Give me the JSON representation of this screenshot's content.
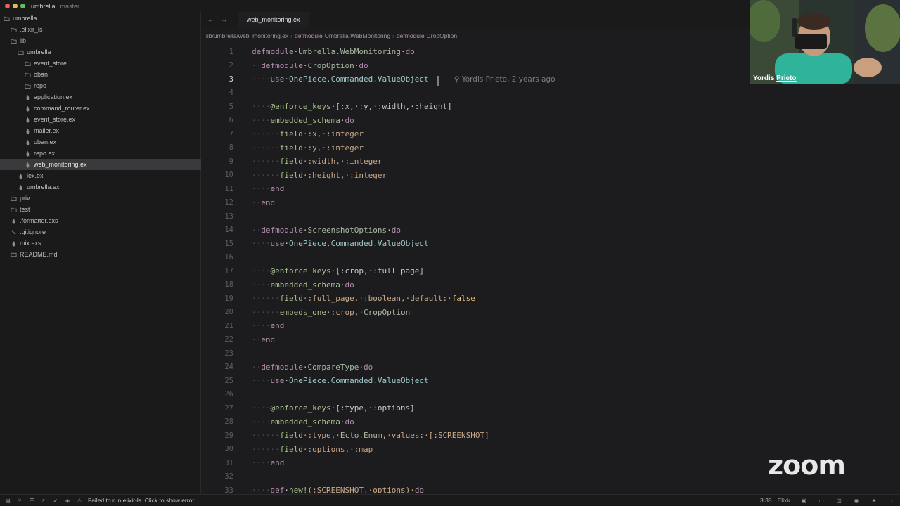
{
  "window": {
    "project": "umbrella",
    "branch": "master"
  },
  "sidebar": {
    "items": [
      {
        "label": "umbrella",
        "icon": "chevron-down-icon",
        "indent": 0,
        "type": "folder-open"
      },
      {
        "label": ".elixir_ls",
        "icon": "folder-icon",
        "indent": 1,
        "type": "folder"
      },
      {
        "label": "lib",
        "icon": "folder-icon",
        "indent": 1,
        "type": "folder-open"
      },
      {
        "label": "umbrella",
        "icon": "folder-icon",
        "indent": 2,
        "type": "folder-open"
      },
      {
        "label": "event_store",
        "icon": "folder-icon",
        "indent": 3,
        "type": "folder"
      },
      {
        "label": "oban",
        "icon": "folder-icon",
        "indent": 3,
        "type": "folder"
      },
      {
        "label": "repo",
        "icon": "folder-icon",
        "indent": 3,
        "type": "folder"
      },
      {
        "label": "application.ex",
        "icon": "elixir-file-icon",
        "indent": 3,
        "type": "file"
      },
      {
        "label": "command_router.ex",
        "icon": "elixir-file-icon",
        "indent": 3,
        "type": "file"
      },
      {
        "label": "event_store.ex",
        "icon": "elixir-file-icon",
        "indent": 3,
        "type": "file"
      },
      {
        "label": "mailer.ex",
        "icon": "elixir-file-icon",
        "indent": 3,
        "type": "file"
      },
      {
        "label": "oban.ex",
        "icon": "elixir-file-icon",
        "indent": 3,
        "type": "file"
      },
      {
        "label": "repo.ex",
        "icon": "elixir-file-icon",
        "indent": 3,
        "type": "file"
      },
      {
        "label": "web_monitoring.ex",
        "icon": "elixir-file-icon",
        "indent": 3,
        "type": "file",
        "selected": true
      },
      {
        "label": "iex.ex",
        "icon": "elixir-file-icon",
        "indent": 2,
        "type": "file"
      },
      {
        "label": "umbrella.ex",
        "icon": "elixir-file-icon",
        "indent": 2,
        "type": "file"
      },
      {
        "label": "priv",
        "icon": "folder-icon",
        "indent": 1,
        "type": "folder"
      },
      {
        "label": "test",
        "icon": "folder-icon",
        "indent": 1,
        "type": "folder"
      },
      {
        "label": ".formatter.exs",
        "icon": "elixir-file-icon",
        "indent": 1,
        "type": "file"
      },
      {
        "label": ".gitignore",
        "icon": "git-icon",
        "indent": 1,
        "type": "file"
      },
      {
        "label": "mix.exs",
        "icon": "elixir-file-icon",
        "indent": 1,
        "type": "file"
      },
      {
        "label": "README.md",
        "icon": "markdown-icon",
        "indent": 1,
        "type": "file"
      }
    ]
  },
  "tabs": {
    "back": "←",
    "forward": "→",
    "active": "web_monitoring.ex"
  },
  "breadcrumb": {
    "path": "lib/umbrella/web_monitoring.ex",
    "kw1": "defmodule",
    "mod1": "Umbrella.WebMonitoring",
    "kw2": "defmodule",
    "mod2": "CropOption",
    "sep": "›"
  },
  "editor": {
    "current_line": 3,
    "blame": "Yordis Prieto, 2 years ago",
    "lines": [
      {
        "n": 1,
        "tokens": [
          [
            "kw",
            "defmodule"
          ],
          [
            "",
            "·"
          ],
          [
            "mod",
            "Umbrella.WebMonitoring"
          ],
          [
            "",
            "·"
          ],
          [
            "kw",
            "do"
          ]
        ]
      },
      {
        "n": 2,
        "tokens": [
          [
            "ws",
            "··"
          ],
          [
            "kw",
            "defmodule"
          ],
          [
            "",
            "·"
          ],
          [
            "mod",
            "CropOption"
          ],
          [
            "",
            "·"
          ],
          [
            "kw",
            "do"
          ]
        ]
      },
      {
        "n": 3,
        "tokens": [
          [
            "ws",
            "····"
          ],
          [
            "kw",
            "use"
          ],
          [
            "",
            "·"
          ],
          [
            "mod2",
            "OnePiece.Commanded.ValueObject"
          ]
        ]
      },
      {
        "n": 4,
        "tokens": []
      },
      {
        "n": 5,
        "tokens": [
          [
            "ws",
            "····"
          ],
          [
            "attr",
            "@enforce_keys"
          ],
          [
            "",
            "·[:x,·:y,·:width,·:height]"
          ]
        ]
      },
      {
        "n": 6,
        "tokens": [
          [
            "ws",
            "····"
          ],
          [
            "fn",
            "embedded_schema"
          ],
          [
            "",
            "·"
          ],
          [
            "kw",
            "do"
          ]
        ]
      },
      {
        "n": 7,
        "tokens": [
          [
            "ws",
            "······"
          ],
          [
            "fn",
            "field"
          ],
          [
            "atom",
            "·:x,·:integer"
          ]
        ]
      },
      {
        "n": 8,
        "tokens": [
          [
            "ws",
            "······"
          ],
          [
            "fn",
            "field"
          ],
          [
            "atom",
            "·:y,·:integer"
          ]
        ]
      },
      {
        "n": 9,
        "tokens": [
          [
            "ws",
            "······"
          ],
          [
            "fn",
            "field"
          ],
          [
            "atom",
            "·:width,·:integer"
          ]
        ]
      },
      {
        "n": 10,
        "tokens": [
          [
            "ws",
            "······"
          ],
          [
            "fn",
            "field"
          ],
          [
            "atom",
            "·:height,·:integer"
          ]
        ]
      },
      {
        "n": 11,
        "tokens": [
          [
            "ws",
            "····"
          ],
          [
            "kw",
            "end"
          ]
        ]
      },
      {
        "n": 12,
        "tokens": [
          [
            "ws",
            "··"
          ],
          [
            "kw",
            "end"
          ]
        ]
      },
      {
        "n": 13,
        "tokens": []
      },
      {
        "n": 14,
        "tokens": [
          [
            "ws",
            "··"
          ],
          [
            "kw",
            "defmodule"
          ],
          [
            "",
            "·"
          ],
          [
            "mod",
            "ScreenshotOptions"
          ],
          [
            "",
            "·"
          ],
          [
            "kw",
            "do"
          ]
        ]
      },
      {
        "n": 15,
        "tokens": [
          [
            "ws",
            "····"
          ],
          [
            "kw",
            "use"
          ],
          [
            "",
            "·"
          ],
          [
            "mod2",
            "OnePiece.Commanded.ValueObject"
          ]
        ]
      },
      {
        "n": 16,
        "tokens": []
      },
      {
        "n": 17,
        "tokens": [
          [
            "ws",
            "····"
          ],
          [
            "attr",
            "@enforce_keys"
          ],
          [
            "",
            "·[:crop,·:full_page]"
          ]
        ]
      },
      {
        "n": 18,
        "tokens": [
          [
            "ws",
            "····"
          ],
          [
            "fn",
            "embedded_schema"
          ],
          [
            "",
            "·"
          ],
          [
            "kw",
            "do"
          ]
        ]
      },
      {
        "n": 19,
        "tokens": [
          [
            "ws",
            "······"
          ],
          [
            "fn",
            "field"
          ],
          [
            "atom",
            "·:full_page,·:boolean,·default:·"
          ],
          [
            "bool",
            "false"
          ]
        ]
      },
      {
        "n": 20,
        "tokens": [
          [
            "ws",
            "······"
          ],
          [
            "fn",
            "embeds_one"
          ],
          [
            "atom",
            "·:crop,·"
          ],
          [
            "mod",
            "CropOption"
          ]
        ]
      },
      {
        "n": 21,
        "tokens": [
          [
            "ws",
            "····"
          ],
          [
            "kw",
            "end"
          ]
        ]
      },
      {
        "n": 22,
        "tokens": [
          [
            "ws",
            "··"
          ],
          [
            "kw",
            "end"
          ]
        ]
      },
      {
        "n": 23,
        "tokens": []
      },
      {
        "n": 24,
        "tokens": [
          [
            "ws",
            "··"
          ],
          [
            "kw",
            "defmodule"
          ],
          [
            "",
            "·"
          ],
          [
            "mod",
            "CompareType"
          ],
          [
            "",
            "·"
          ],
          [
            "kw",
            "do"
          ]
        ]
      },
      {
        "n": 25,
        "tokens": [
          [
            "ws",
            "····"
          ],
          [
            "kw",
            "use"
          ],
          [
            "",
            "·"
          ],
          [
            "mod2",
            "OnePiece.Commanded.ValueObject"
          ]
        ]
      },
      {
        "n": 26,
        "tokens": []
      },
      {
        "n": 27,
        "tokens": [
          [
            "ws",
            "····"
          ],
          [
            "attr",
            "@enforce_keys"
          ],
          [
            "",
            "·[:type,·:options]"
          ]
        ]
      },
      {
        "n": 28,
        "tokens": [
          [
            "ws",
            "····"
          ],
          [
            "fn",
            "embedded_schema"
          ],
          [
            "",
            "·"
          ],
          [
            "kw",
            "do"
          ]
        ]
      },
      {
        "n": 29,
        "tokens": [
          [
            "ws",
            "······"
          ],
          [
            "fn",
            "field"
          ],
          [
            "atom",
            "·:type,·"
          ],
          [
            "mod",
            "Ecto.Enum"
          ],
          [
            "atom",
            ",·values:·[:SCREENSHOT]"
          ]
        ]
      },
      {
        "n": 30,
        "tokens": [
          [
            "ws",
            "······"
          ],
          [
            "fn",
            "field"
          ],
          [
            "atom",
            "·:options,·:map"
          ]
        ]
      },
      {
        "n": 31,
        "tokens": [
          [
            "ws",
            "····"
          ],
          [
            "kw",
            "end"
          ]
        ]
      },
      {
        "n": 32,
        "tokens": []
      },
      {
        "n": 33,
        "tokens": [
          [
            "ws",
            "····"
          ],
          [
            "kw",
            "def"
          ],
          [
            "",
            "·"
          ],
          [
            "fn",
            "new!"
          ],
          [
            "atom",
            "(:SCREENSHOT,·options)·"
          ],
          [
            "kw",
            "do"
          ]
        ]
      }
    ]
  },
  "overlay": {
    "zoom_logo": "zoom",
    "webcam_name_first": "Yordis",
    "webcam_name_last": "Prieto"
  },
  "statusbar": {
    "message": "Failed to run elixir-ls. Click to show error.",
    "cursor_pos": "3:38",
    "language": "Elixir"
  },
  "colors": {
    "accent": "#b48ead",
    "background": "#1c1c1e",
    "sidebar": "#1a1a1b"
  }
}
